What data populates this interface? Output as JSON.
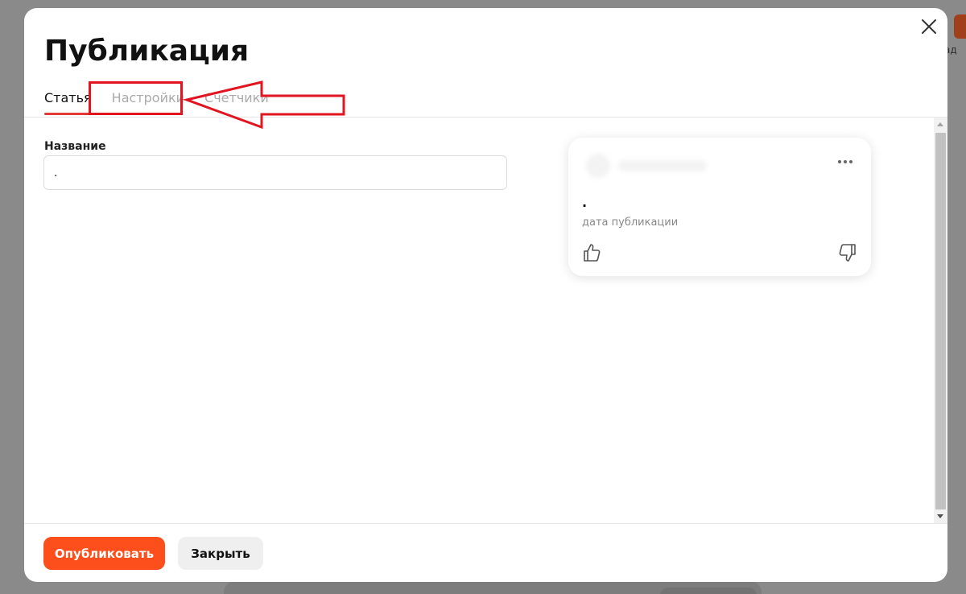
{
  "background": {
    "partial_text": "ад"
  },
  "modal": {
    "title": "Публикация",
    "tabs": [
      {
        "label": "Статья",
        "active": true
      },
      {
        "label": "Настройки",
        "active": false
      },
      {
        "label": "Счетчики",
        "active": false
      }
    ],
    "form": {
      "name_label": "Название",
      "name_value": "."
    },
    "preview": {
      "title": ".",
      "date_placeholder": "дата публикации",
      "more_icon": "more-horizontal-icon",
      "like_icon": "thumbs-up-icon",
      "dislike_icon": "thumbs-down-icon"
    },
    "footer": {
      "publish_label": "Опубликовать",
      "close_label": "Закрыть"
    }
  },
  "colors": {
    "accent": "#fc4f1b",
    "tab_underline": "#e53935",
    "annotation": "#e1141f"
  }
}
